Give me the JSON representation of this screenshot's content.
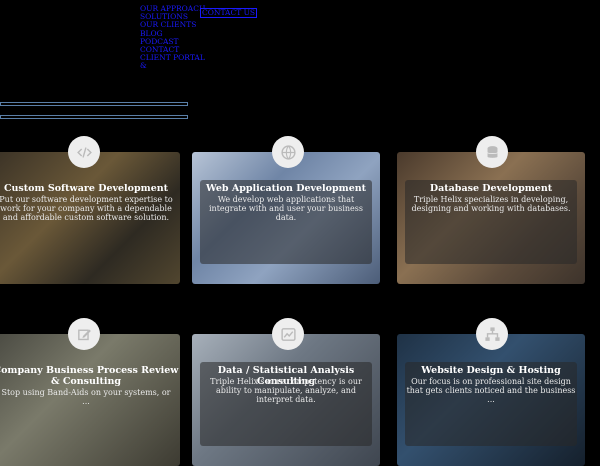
{
  "nav": {
    "items": [
      "OUR APPROACH",
      "SOLUTIONS",
      "OUR CLIENTS",
      "BLOG",
      "PODCAST",
      "CONTACT",
      "CLIENT PORTAL",
      "&"
    ],
    "contact_button": "CONTACT US"
  },
  "services": [
    {
      "title": "Custom Software Development",
      "description": "Put our software development expertise to work for your company with a dependable and affordable custom software solution.",
      "icon": "code-icon"
    },
    {
      "title": "Web Application Development",
      "description": "We develop web applications that integrate with and user your business data.",
      "icon": "globe-icon"
    },
    {
      "title": "Database Development",
      "description": "Triple Helix specializes in developing, designing and working with databases.",
      "icon": "database-icon"
    },
    {
      "title": "Company Business Process Review & Consulting",
      "description": "Stop using Band-Aids on your systems, or ...",
      "icon": "edit-icon"
    },
    {
      "title": "Data / Statistical Analysis Consulting",
      "description": "Triple Helix's core competency is our ability to manipulate, analyze, and interpret data.",
      "icon": "chart-icon"
    },
    {
      "title": "Website Design & Hosting",
      "description": "Our focus is on professional site design that gets clients noticed and the business ...",
      "icon": "sitemap-icon"
    }
  ],
  "colors": {
    "link": "#1a1aff",
    "background": "#000000",
    "bar_border": "#5a7fa8"
  }
}
